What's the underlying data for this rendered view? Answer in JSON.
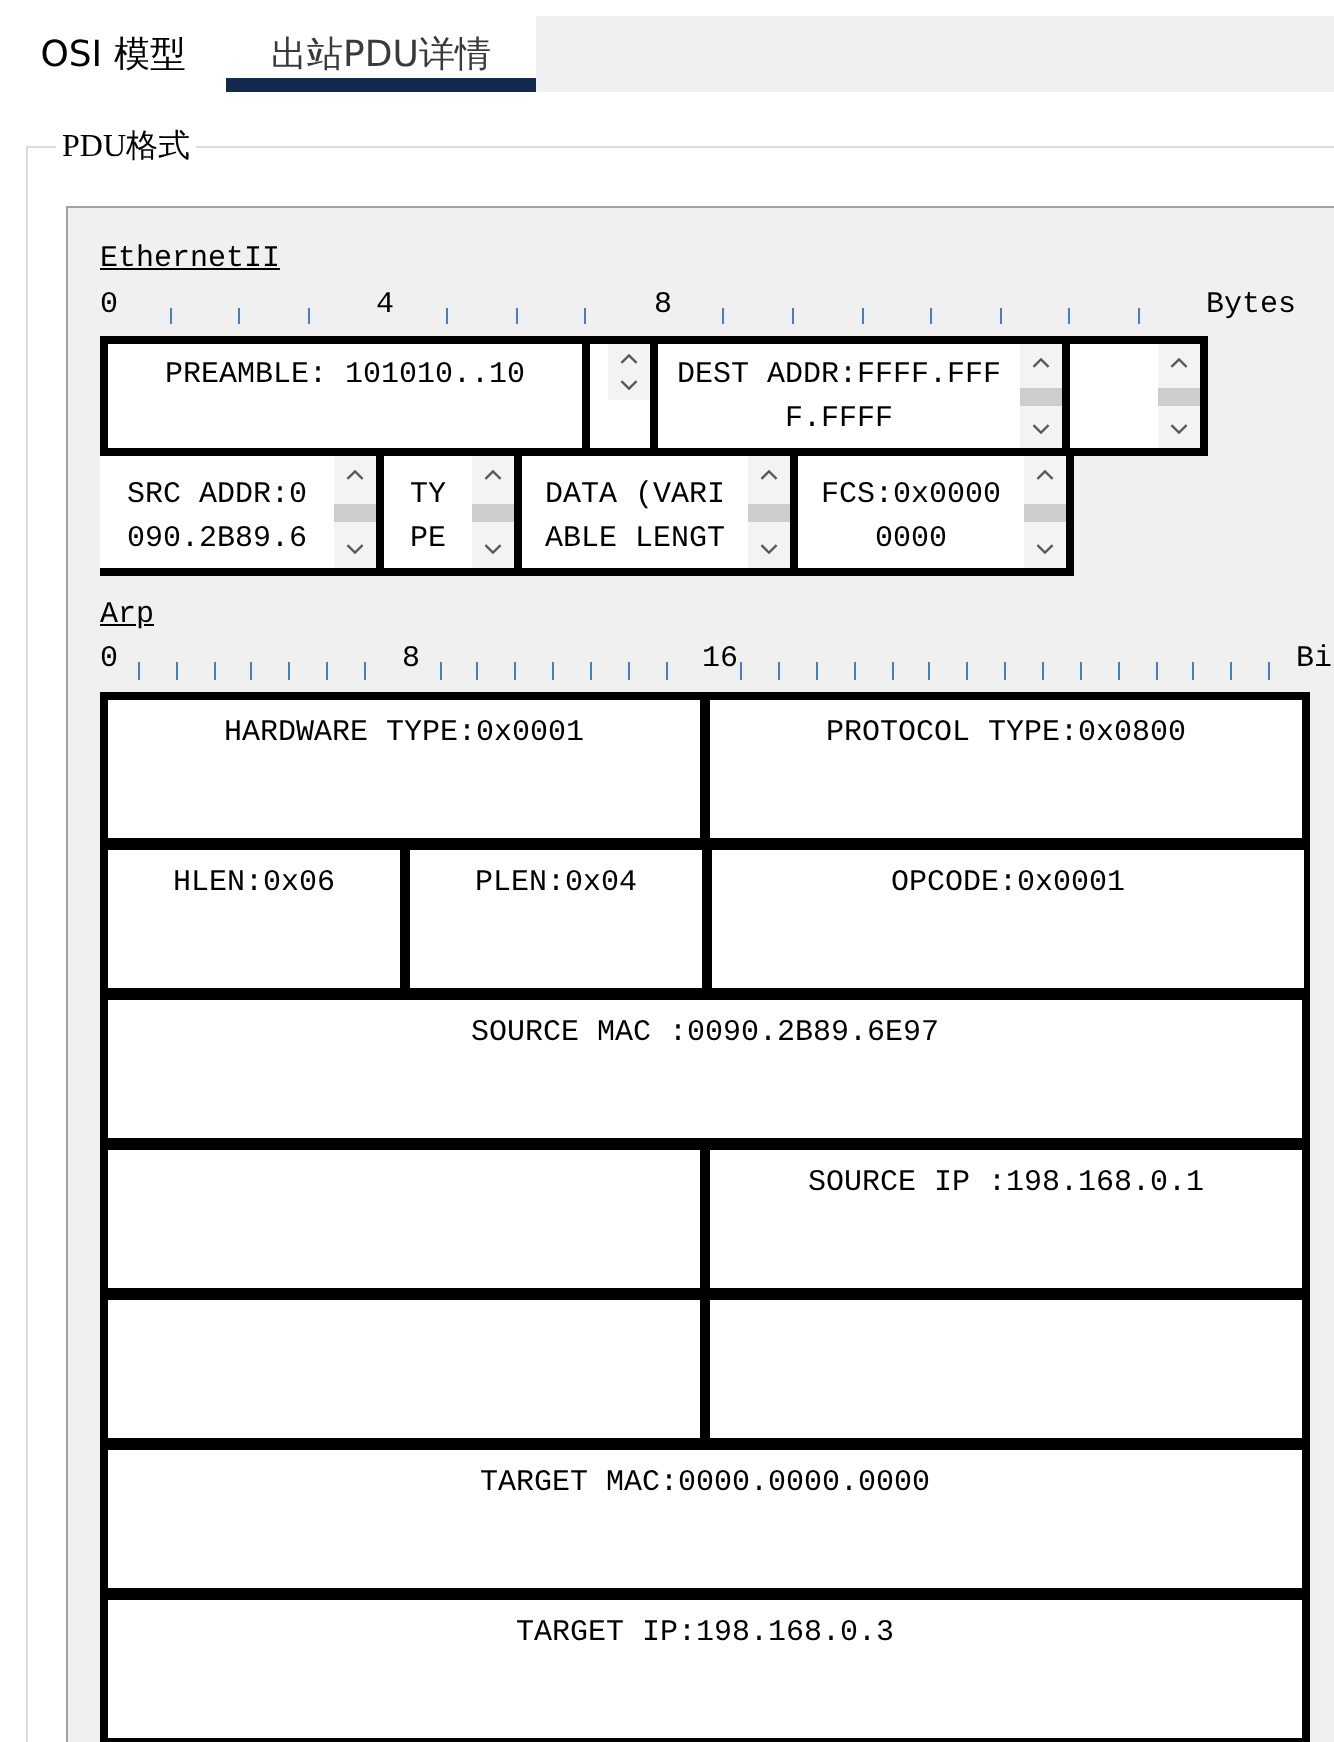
{
  "tabs": [
    {
      "label": "OSI 模型",
      "selected": false
    },
    {
      "label": "出站PDU详情",
      "selected": true
    }
  ],
  "group": {
    "title": "PDU格式",
    "sections": [
      {
        "kind": "ethernet",
        "title": "EthernetII",
        "ruler": {
          "marks": [
            "0",
            "4",
            "8"
          ],
          "unit": "Bytes"
        },
        "rows": [
          [
            {
              "kind": "label",
              "colspan": 7,
              "text": "PREAMBLE: 101010..10"
            },
            {
              "kind": "arrows"
            },
            {
              "kind": "scroll",
              "colspan": 6,
              "text": "DEST ADDR:FFFF.FFFF.FFFF"
            },
            {
              "kind": "scroll",
              "colspan": 2
            }
          ],
          [
            {
              "kind": "scroll",
              "colspan": 4,
              "text": "SRC ADDR:0090.2B89.6"
            },
            {
              "kind": "scroll",
              "colspan": 2,
              "text": "TYPE"
            },
            {
              "kind": "scroll",
              "colspan": 4,
              "text": "DATA (VARIABLE LENGT"
            },
            {
              "kind": "scroll",
              "colspan": 4,
              "text": "FCS:0x00000000"
            }
          ]
        ]
      },
      {
        "kind": "arp",
        "title": "Arp",
        "ruler": {
          "marks": [
            "0",
            "8",
            "16"
          ],
          "unit": "Bi"
        },
        "rows": [
          [
            {
              "kind": "field",
              "colspan": 2,
              "text": "HARDWARE TYPE:0x0001"
            },
            {
              "kind": "field",
              "colspan": 2,
              "text": "PROTOCOL TYPE:0x0800"
            }
          ],
          [
            {
              "kind": "field",
              "text": "HLEN:0x06"
            },
            {
              "kind": "field",
              "text": "PLEN:0x04"
            },
            {
              "kind": "field",
              "colspan": 2,
              "text": "OPCODE:0x0001"
            }
          ],
          [
            {
              "kind": "field",
              "colspan": 4,
              "text": "SOURCE MAC :0090.2B89.6E97"
            }
          ],
          [
            {
              "kind": "blank",
              "colspan": 2
            },
            {
              "kind": "field",
              "colspan": 2,
              "text": "SOURCE IP :198.168.0.1"
            }
          ],
          [
            {
              "kind": "blank",
              "colspan": 2
            },
            {
              "kind": "blank",
              "colspan": 2
            }
          ],
          [
            {
              "kind": "field",
              "colspan": 4,
              "text": "TARGET MAC:0000.0000.0000"
            }
          ],
          [
            {
              "kind": "field",
              "colspan": 4,
              "text": "TARGET IP:198.168.0.3"
            }
          ]
        ]
      }
    ]
  }
}
